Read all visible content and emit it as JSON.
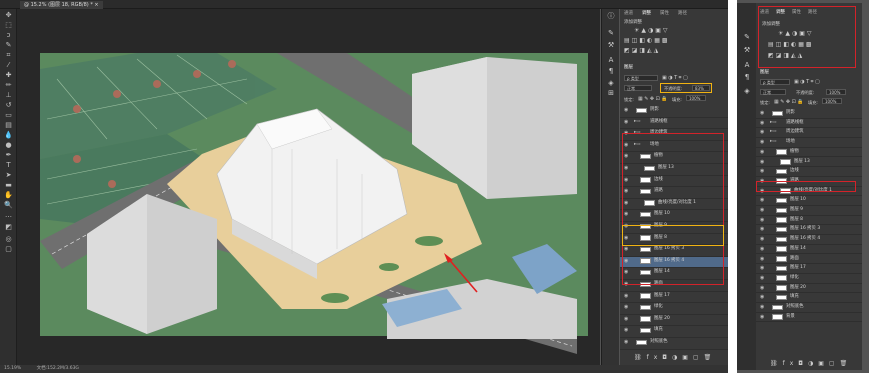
{
  "document": {
    "tab_title": "@ 15.2% (图层 18, RGB/8) *"
  },
  "statusbar": {
    "zoom": "15.19%",
    "doc_info": "文档:152.2M/3.63G"
  },
  "panel_tabs": [
    "通道",
    "调整",
    "属性",
    "路径"
  ],
  "adjustments": {
    "title": "添加调整"
  },
  "layers_panel": {
    "tab": "图层",
    "kind_label": "类型",
    "blend_mode": "正常",
    "opacity_label": "不透明度:",
    "opacity_value": "83%",
    "lock_label": "锁定:",
    "fill_label": "填充:",
    "fill_value": "100%",
    "layers": [
      {
        "name": "阴影"
      },
      {
        "name": "道路线框"
      },
      {
        "name": "周边建筑"
      },
      {
        "name": "场地"
      },
      {
        "name": "植物"
      },
      {
        "name": "图层 13"
      },
      {
        "name": "边线"
      },
      {
        "name": "道路"
      },
      {
        "name": "曲线/亮度/对比度 1"
      },
      {
        "name": "图层 10"
      },
      {
        "name": "图层 9"
      },
      {
        "name": "图层 8"
      },
      {
        "name": "图层 16 拷贝 3"
      },
      {
        "name": "图层 16 拷贝 4"
      },
      {
        "name": "图层 14"
      },
      {
        "name": "路面"
      },
      {
        "name": "图层 17"
      },
      {
        "name": "绿化"
      },
      {
        "name": "图层 20"
      },
      {
        "name": "填充"
      },
      {
        "name": "对照底色"
      }
    ]
  },
  "right_panel": {
    "tabs": [
      "通道",
      "调整",
      "属性",
      "路径"
    ],
    "adjust_title": "添加调整",
    "layers_tab": "图层",
    "kind_label": "类型",
    "blend_mode": "正常",
    "opacity_label": "不透明度:",
    "opacity_value": "100%",
    "lock_label": "锁定:",
    "fill_label": "填充:",
    "fill_value": "100%",
    "layers": [
      {
        "name": "阴影"
      },
      {
        "name": "道路线框"
      },
      {
        "name": "周边建筑"
      },
      {
        "name": "场地"
      },
      {
        "name": "植物"
      },
      {
        "name": "图层 13"
      },
      {
        "name": "边线"
      },
      {
        "name": "道路"
      },
      {
        "name": "曲线/亮度/对比度 1"
      },
      {
        "name": "图层 10"
      },
      {
        "name": "图层 9"
      },
      {
        "name": "图层 8"
      },
      {
        "name": "图层 16 拷贝 3"
      },
      {
        "name": "图层 16 拷贝 4"
      },
      {
        "name": "图层 14"
      },
      {
        "name": "路面"
      },
      {
        "name": "图层 17"
      },
      {
        "name": "绿化"
      },
      {
        "name": "图层 20"
      },
      {
        "name": "填充"
      },
      {
        "name": "对照底色"
      },
      {
        "name": "背景"
      }
    ]
  }
}
